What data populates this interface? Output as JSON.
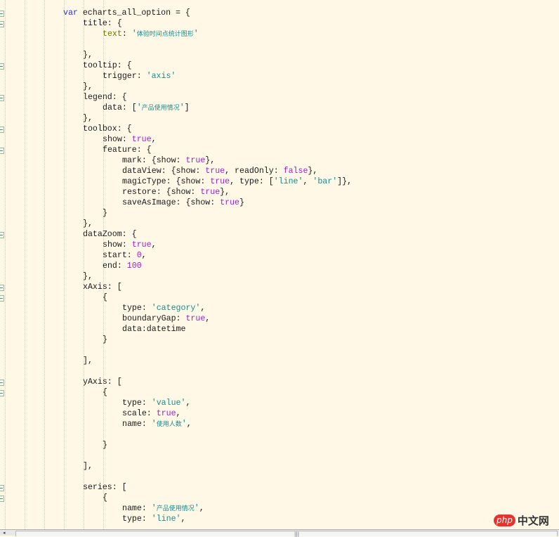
{
  "editor": {
    "lines": [
      {
        "indent": 0,
        "fold": true,
        "tokens": [
          [
            "var",
            "kw"
          ],
          [
            " echarts_all_option = {",
            ""
          ]
        ]
      },
      {
        "indent": 1,
        "fold": true,
        "tokens": [
          [
            "title: {",
            ""
          ]
        ]
      },
      {
        "indent": 2,
        "fold": false,
        "tokens": [
          [
            "text",
            "key"
          ],
          [
            ": ",
            ""
          ],
          [
            "'",
            "str"
          ],
          [
            "体验时间点统计图形",
            "cjk"
          ],
          [
            "'",
            "str"
          ]
        ]
      },
      {
        "indent": 0,
        "fold": false,
        "tokens": []
      },
      {
        "indent": 1,
        "fold": false,
        "tokens": [
          [
            "},",
            ""
          ]
        ]
      },
      {
        "indent": 1,
        "fold": true,
        "tokens": [
          [
            "tooltip: {",
            ""
          ]
        ]
      },
      {
        "indent": 2,
        "fold": false,
        "tokens": [
          [
            "trigger: ",
            ""
          ],
          [
            "'axis'",
            "str"
          ]
        ]
      },
      {
        "indent": 1,
        "fold": false,
        "tokens": [
          [
            "},",
            ""
          ]
        ]
      },
      {
        "indent": 1,
        "fold": true,
        "tokens": [
          [
            "legend: {",
            ""
          ]
        ]
      },
      {
        "indent": 2,
        "fold": false,
        "tokens": [
          [
            "data: [",
            ""
          ],
          [
            "'",
            "str"
          ],
          [
            "产品使用情况",
            "cjk"
          ],
          [
            "'",
            "str"
          ],
          [
            "]",
            ""
          ]
        ]
      },
      {
        "indent": 1,
        "fold": false,
        "tokens": [
          [
            "},",
            ""
          ]
        ]
      },
      {
        "indent": 1,
        "fold": true,
        "tokens": [
          [
            "toolbox: {",
            ""
          ]
        ]
      },
      {
        "indent": 2,
        "fold": false,
        "tokens": [
          [
            "show: ",
            ""
          ],
          [
            "true",
            "lit"
          ],
          [
            ",",
            ""
          ]
        ]
      },
      {
        "indent": 2,
        "fold": true,
        "tokens": [
          [
            "feature: {",
            ""
          ]
        ]
      },
      {
        "indent": 3,
        "fold": false,
        "tokens": [
          [
            "mark: {show: ",
            ""
          ],
          [
            "true",
            "lit"
          ],
          [
            "},",
            ""
          ]
        ]
      },
      {
        "indent": 3,
        "fold": false,
        "tokens": [
          [
            "dataView: {show: ",
            ""
          ],
          [
            "true",
            "lit"
          ],
          [
            ", readOnly: ",
            ""
          ],
          [
            "false",
            "lit"
          ],
          [
            "},",
            ""
          ]
        ]
      },
      {
        "indent": 3,
        "fold": false,
        "tokens": [
          [
            "magicType: {show: ",
            ""
          ],
          [
            "true",
            "lit"
          ],
          [
            ", type: [",
            ""
          ],
          [
            "'line'",
            "str"
          ],
          [
            ", ",
            ""
          ],
          [
            "'bar'",
            "str"
          ],
          [
            "]},",
            ""
          ]
        ]
      },
      {
        "indent": 3,
        "fold": false,
        "tokens": [
          [
            "restore: {show: ",
            ""
          ],
          [
            "true",
            "lit"
          ],
          [
            "},",
            ""
          ]
        ]
      },
      {
        "indent": 3,
        "fold": false,
        "tokens": [
          [
            "saveAsImage: {show: ",
            ""
          ],
          [
            "true",
            "lit"
          ],
          [
            "}",
            ""
          ]
        ]
      },
      {
        "indent": 2,
        "fold": false,
        "tokens": [
          [
            "}",
            ""
          ]
        ]
      },
      {
        "indent": 1,
        "fold": false,
        "tokens": [
          [
            "},",
            ""
          ]
        ]
      },
      {
        "indent": 1,
        "fold": true,
        "tokens": [
          [
            "dataZoom: {",
            ""
          ]
        ]
      },
      {
        "indent": 2,
        "fold": false,
        "tokens": [
          [
            "show: ",
            ""
          ],
          [
            "true",
            "lit"
          ],
          [
            ",",
            ""
          ]
        ]
      },
      {
        "indent": 2,
        "fold": false,
        "tokens": [
          [
            "start: ",
            ""
          ],
          [
            "0",
            "lit"
          ],
          [
            ",",
            ""
          ]
        ]
      },
      {
        "indent": 2,
        "fold": false,
        "tokens": [
          [
            "end: ",
            ""
          ],
          [
            "100",
            "lit"
          ]
        ]
      },
      {
        "indent": 1,
        "fold": false,
        "tokens": [
          [
            "},",
            ""
          ]
        ]
      },
      {
        "indent": 1,
        "fold": true,
        "tokens": [
          [
            "xAxis: [",
            ""
          ]
        ]
      },
      {
        "indent": 2,
        "fold": true,
        "tokens": [
          [
            "{",
            ""
          ]
        ]
      },
      {
        "indent": 3,
        "fold": false,
        "tokens": [
          [
            "type: ",
            ""
          ],
          [
            "'category'",
            "str"
          ],
          [
            ",",
            ""
          ]
        ]
      },
      {
        "indent": 3,
        "fold": false,
        "tokens": [
          [
            "boundaryGap: ",
            ""
          ],
          [
            "true",
            "lit"
          ],
          [
            ",",
            ""
          ]
        ]
      },
      {
        "indent": 3,
        "fold": false,
        "tokens": [
          [
            "data:datetime",
            ""
          ]
        ]
      },
      {
        "indent": 2,
        "fold": false,
        "tokens": [
          [
            "}",
            ""
          ]
        ]
      },
      {
        "indent": 0,
        "fold": false,
        "tokens": []
      },
      {
        "indent": 1,
        "fold": false,
        "tokens": [
          [
            "],",
            ""
          ]
        ]
      },
      {
        "indent": 0,
        "fold": false,
        "tokens": []
      },
      {
        "indent": 1,
        "fold": true,
        "tokens": [
          [
            "yAxis: [",
            ""
          ]
        ]
      },
      {
        "indent": 2,
        "fold": true,
        "tokens": [
          [
            "{",
            ""
          ]
        ]
      },
      {
        "indent": 3,
        "fold": false,
        "tokens": [
          [
            "type: ",
            ""
          ],
          [
            "'value'",
            "str"
          ],
          [
            ",",
            ""
          ]
        ]
      },
      {
        "indent": 3,
        "fold": false,
        "tokens": [
          [
            "scale: ",
            ""
          ],
          [
            "true",
            "lit"
          ],
          [
            ",",
            ""
          ]
        ]
      },
      {
        "indent": 3,
        "fold": false,
        "tokens": [
          [
            "name: ",
            ""
          ],
          [
            "'",
            "str"
          ],
          [
            "使用人数",
            "cjk"
          ],
          [
            "'",
            "str"
          ],
          [
            ",",
            ""
          ]
        ]
      },
      {
        "indent": 0,
        "fold": false,
        "tokens": []
      },
      {
        "indent": 2,
        "fold": false,
        "tokens": [
          [
            "}",
            ""
          ]
        ]
      },
      {
        "indent": 0,
        "fold": false,
        "tokens": []
      },
      {
        "indent": 1,
        "fold": false,
        "tokens": [
          [
            "],",
            ""
          ]
        ]
      },
      {
        "indent": 0,
        "fold": false,
        "tokens": []
      },
      {
        "indent": 1,
        "fold": true,
        "tokens": [
          [
            "series: [",
            ""
          ]
        ]
      },
      {
        "indent": 2,
        "fold": true,
        "tokens": [
          [
            "{",
            ""
          ]
        ]
      },
      {
        "indent": 3,
        "fold": false,
        "tokens": [
          [
            "name: ",
            ""
          ],
          [
            "'",
            "str"
          ],
          [
            "产品使用情况",
            "cjk"
          ],
          [
            "'",
            "str"
          ],
          [
            ",",
            ""
          ]
        ]
      },
      {
        "indent": 3,
        "fold": false,
        "tokens": [
          [
            "type: ",
            ""
          ],
          [
            "'line'",
            "str"
          ],
          [
            ",",
            ""
          ]
        ]
      }
    ]
  },
  "scrollbar": {
    "left_arrow": "◂",
    "grip": "|||"
  },
  "watermark": {
    "php": "php",
    "cn": "中文网"
  }
}
